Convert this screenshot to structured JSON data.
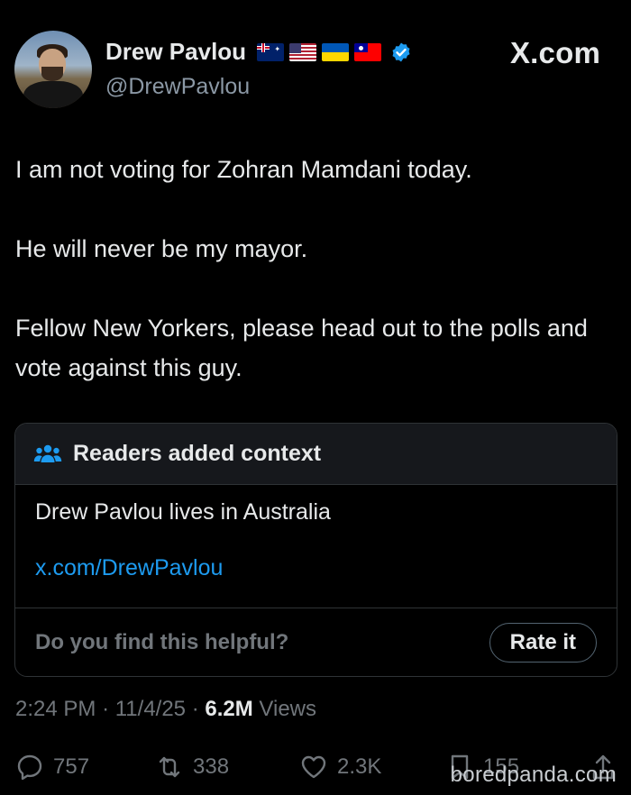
{
  "header": {
    "name": "Drew Pavlou",
    "handle": "@DrewPavlou",
    "site": "X.com"
  },
  "tweet": {
    "paragraphs": [
      "I am not voting for Zohran Mamdani today.",
      "He will never be my mayor.",
      "Fellow New Yorkers, please head out to the polls and vote against this guy."
    ]
  },
  "note": {
    "title": "Readers added context",
    "text": "Drew Pavlou lives in Australia",
    "link": "x.com/DrewPavlou",
    "question": "Do you find this helpful?",
    "button": "Rate it"
  },
  "meta": {
    "time": "2:24 PM",
    "date": "11/4/25",
    "views_count": "6.2M",
    "views_label": "Views"
  },
  "actions": {
    "replies": "757",
    "reposts": "338",
    "likes": "2.3K",
    "bookmarks": "155"
  },
  "watermark": "boredpanda.com",
  "colors": {
    "background": "#000000",
    "text": "#e7e9ea",
    "muted": "#71767b",
    "link": "#1d9bf0",
    "verified": "#1d9bf0",
    "note_header": "#16181c"
  }
}
